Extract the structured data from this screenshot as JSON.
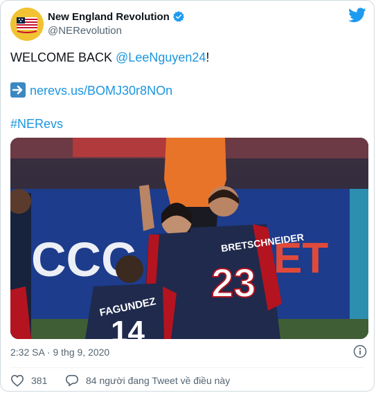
{
  "account": {
    "name": "New England Revolution",
    "handle": "@NERevolution"
  },
  "tweet": {
    "text_prefix": "WELCOME BACK ",
    "mention": "@LeeNguyen24",
    "text_suffix": "!",
    "link": "nerevs.us/BOMJ30r8NOn",
    "hashtag": "#NERevs"
  },
  "media": {
    "jersey_front_name": "FAGUNDEZ",
    "jersey_front_number": "14",
    "jersey_right_name": "BRETSCHNEIDER",
    "jersey_right_number": "23",
    "board_text": "CCC",
    "board_text_right": "ET"
  },
  "meta": {
    "timestamp": "2:32 SA · 9 thg 9, 2020"
  },
  "actions": {
    "likes": "381",
    "replies_label": "84 người đang Tweet về điều này"
  },
  "colors": {
    "link": "#1b95e0",
    "verified": "#1d9bf0",
    "like": "#e0245e"
  },
  "icons": [
    "verified-badge-icon",
    "twitter-bird-icon",
    "arrow-right-icon",
    "info-icon",
    "heart-icon",
    "reply-bubble-icon"
  ]
}
